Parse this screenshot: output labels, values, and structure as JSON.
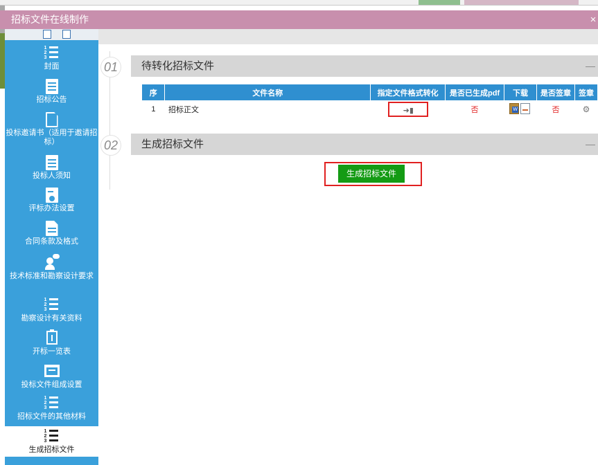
{
  "window": {
    "title": "招标文件在线制作",
    "close_glyph": "×"
  },
  "sidebar": {
    "items": [
      {
        "label": "封面",
        "icon": "numbered-list-icon"
      },
      {
        "label": "招标公告",
        "icon": "document-icon"
      },
      {
        "label": "投标邀请书（适用于邀请招标）",
        "icon": "zb-document-icon"
      },
      {
        "label": "投标人须知",
        "icon": "document-icon"
      },
      {
        "label": "评标办法设置",
        "icon": "settings-document-icon"
      },
      {
        "label": "合同条款及格式",
        "icon": "document-icon"
      },
      {
        "label": "技术标准和勘察设计要求",
        "icon": "user-comment-icon"
      },
      {
        "label": "勘察设计有关资料",
        "icon": "numbered-list-icon"
      },
      {
        "label": "开标一览表",
        "icon": "upload-clipboard-icon"
      },
      {
        "label": "投标文件组成设置",
        "icon": "image-edit-icon"
      },
      {
        "label": "招标文件的其他材料",
        "icon": "numbered-list-icon"
      },
      {
        "label": "生成招标文件",
        "icon": "numbered-list-icon",
        "active": true
      }
    ]
  },
  "sections": [
    {
      "number": "01",
      "title": "待转化招标文件",
      "collapse": "—"
    },
    {
      "number": "02",
      "title": "生成招标文件",
      "collapse": "—"
    }
  ],
  "table": {
    "headers": [
      "序",
      "文件名称",
      "指定文件格式转化",
      "是否已生成pdf",
      "下载",
      "是否签章",
      "签章"
    ],
    "rows": [
      {
        "index": "1",
        "name": "招标正文",
        "pdf_generated": "否",
        "signed": "否"
      }
    ]
  },
  "generate_button": {
    "label": "生成招标文件"
  },
  "colors": {
    "titlebar": "#c88fad",
    "sidebar": "#3aa0db",
    "table_header": "#2f8fd0",
    "button": "#149b14",
    "highlight": "#e02020"
  }
}
